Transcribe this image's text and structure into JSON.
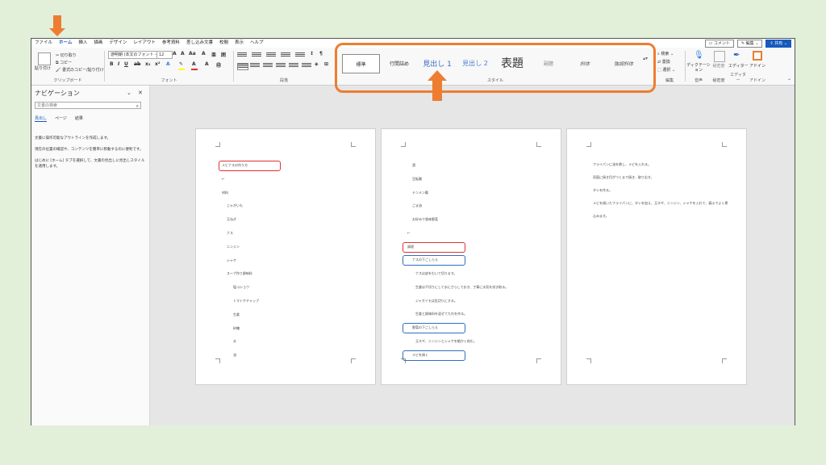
{
  "menu_tabs": [
    "ファイル",
    "ホーム",
    "挿入",
    "描画",
    "デザイン",
    "レイアウト",
    "参考資料",
    "差し込み文書",
    "校閲",
    "表示",
    "ヘルプ"
  ],
  "menu_right": {
    "comment": "コメント",
    "edit": "編集",
    "share": "共有"
  },
  "clipboard": {
    "paste": "貼り付け",
    "cut": "切り取り",
    "copy": "コピー",
    "format_copy": "書式のコピー/貼り付け",
    "label": "クリップボード"
  },
  "font": {
    "name": "游明朝 (本文のフォント -",
    "size": "12",
    "label": "フォント"
  },
  "paragraph": {
    "label": "段落"
  },
  "styles": {
    "items": [
      "標準",
      "行間詰め",
      "見出し 1",
      "見出し 2",
      "表題",
      "副題",
      "斜体",
      "強調斜体"
    ],
    "label": "スタイル"
  },
  "editing": {
    "find": "検索",
    "replace": "置換",
    "select": "選択",
    "label": "編集"
  },
  "voice": {
    "dictate": "ディクテーション",
    "label": "音声"
  },
  "sensitivity": {
    "name": "秘密度",
    "label": "秘密度"
  },
  "editor": {
    "name": "エディター",
    "label": "エディター"
  },
  "addins": {
    "name": "アドイン",
    "label": "アドイン"
  },
  "nav_pane": {
    "title": "ナビゲーション",
    "search_placeholder": "文書の検索",
    "tabs": [
      "見出し",
      "ページ",
      "結果"
    ],
    "msg1": "文書に操作可能なアウトラインを作成します。",
    "msg2": "現在の位置の確認や、コンテンツを簡単に移動するのに便利です。",
    "msg3": "はじめに [ホーム] タブを選択して、文書の見出しに見出しスタイルを適用します。"
  },
  "page1": {
    "heading": "メビナスの作り方",
    "lines": [
      "材料",
      "じゃがいも",
      "玉ねぎ",
      "ナス",
      "ニンジン",
      "シャケ",
      "スープ作り調味料",
      "塩コショウ",
      "トマトケチャップ",
      "生姜",
      "砂糖",
      "水",
      "油"
    ]
  },
  "page2": {
    "lines_top": [
      "酒",
      "豆板醤",
      "テンメン醤",
      "ごま油",
      "お好みで香味野菜"
    ],
    "heading_red": "調理",
    "heading_blue1": "ナスの下ごしらえ",
    "paras1": [
      "ナスは皮をむいて切ります。",
      "生姜は千切りにして水にさらしておき、丁寧に水気を拭き取る。",
      "ジャガイモは乱切りにする。",
      "生姜と調味料を混ぜてたれを作る。"
    ],
    "heading_blue2": "野菜の下ごしらえ",
    "paras2": [
      "玉ネギ、ニンジンとシャケを細かく刻む。"
    ],
    "heading_blue3": "メビを焼く"
  },
  "page3": {
    "text": "フライパンに油を熱し、メビを入れる。\n両面に焼き目がつくまで焼き、取り出す。\nタレを作る。\nメビを焼いたフライパンに、タレを加え、玉ネギ、ニンジン、シャケを入れて、弱火でよく煮込みます。"
  },
  "colors": {
    "accent": "#ed7d31",
    "brand": "#185abd",
    "red_box": "#e03030",
    "blue_box": "#2e6fc0"
  }
}
